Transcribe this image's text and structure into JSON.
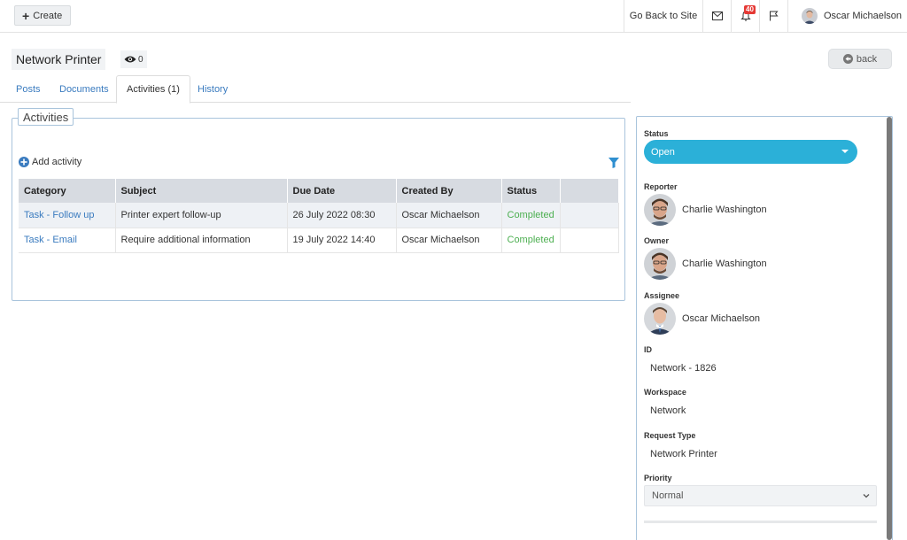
{
  "header": {
    "create_label": "Create",
    "go_back_label": "Go Back to Site",
    "notification_count": "40",
    "user_name": "Oscar Michaelson"
  },
  "title": {
    "name": "Network Printer",
    "watchers": "0",
    "back_label": "back"
  },
  "tabs": [
    {
      "label": "Posts",
      "active": false
    },
    {
      "label": "Documents",
      "active": false
    },
    {
      "label": "Activities (1)",
      "active": true
    },
    {
      "label": "History",
      "active": false
    }
  ],
  "activities": {
    "legend": "Activities",
    "add_label": "Add activity",
    "columns": [
      "Category",
      "Subject",
      "Due Date",
      "Created By",
      "Status",
      ""
    ],
    "rows": [
      {
        "category": "Task - Follow up",
        "subject": "Printer expert follow-up",
        "due": "26 July 2022 08:30",
        "created_by": "Oscar Michaelson",
        "status": "Completed"
      },
      {
        "category": "Task - Email",
        "subject": "Require additional information",
        "due": "19 July 2022 14:40",
        "created_by": "Oscar Michaelson",
        "status": "Completed"
      }
    ]
  },
  "details": {
    "status_label": "Status",
    "status_value": "Open",
    "reporter_label": "Reporter",
    "reporter_name": "Charlie Washington",
    "owner_label": "Owner",
    "owner_name": "Charlie Washington",
    "assignee_label": "Assignee",
    "assignee_name": "Oscar Michaelson",
    "id_label": "ID",
    "id_value": "Network - 1826",
    "workspace_label": "Workspace",
    "workspace_value": "Network",
    "request_type_label": "Request Type",
    "request_type_value": "Network Printer",
    "priority_label": "Priority",
    "priority_value": "Normal"
  },
  "colors": {
    "accent": "#2bb0d8",
    "link": "#3a7bbf",
    "completed": "#4caf50",
    "badge": "#e53935"
  }
}
